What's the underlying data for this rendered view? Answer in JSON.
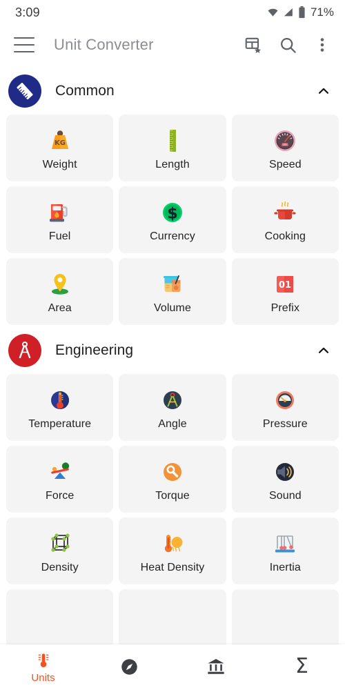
{
  "status_bar": {
    "time": "3:09",
    "battery_percent": "71%",
    "icons": [
      "wifi-icon",
      "signal-icon",
      "battery-icon"
    ]
  },
  "app_bar": {
    "menu_icon": "hamburger-menu-icon",
    "title": "Unit Converter",
    "actions": [
      {
        "name": "favorites-table-icon",
        "label": "Favorites"
      },
      {
        "name": "search-icon",
        "label": "Search"
      },
      {
        "name": "overflow-menu-icon",
        "label": "More options"
      }
    ]
  },
  "sections": [
    {
      "id": "common",
      "title": "Common",
      "icon": "ruler-icon",
      "circle_color": "#1f2b87",
      "expanded": true,
      "chevron": "chevron-up-icon",
      "items": [
        {
          "label": "Weight",
          "icon": "weight-kg-icon"
        },
        {
          "label": "Length",
          "icon": "ruler-green-icon"
        },
        {
          "label": "Speed",
          "icon": "speedometer-icon"
        },
        {
          "label": "Fuel",
          "icon": "fuel-pump-icon"
        },
        {
          "label": "Currency",
          "icon": "dollar-coin-icon"
        },
        {
          "label": "Cooking",
          "icon": "cooking-pot-icon"
        },
        {
          "label": "Area",
          "icon": "map-pin-icon"
        },
        {
          "label": "Volume",
          "icon": "beakers-icon"
        },
        {
          "label": "Prefix",
          "icon": "calendar-01-icon"
        }
      ]
    },
    {
      "id": "engineering",
      "title": "Engineering",
      "icon": "compass-divider-icon",
      "circle_color": "#cf2027",
      "expanded": true,
      "chevron": "chevron-up-icon",
      "items": [
        {
          "label": "Temperature",
          "icon": "thermometer-circle-icon"
        },
        {
          "label": "Angle",
          "icon": "protractor-compass-icon"
        },
        {
          "label": "Pressure",
          "icon": "pressure-gauge-icon"
        },
        {
          "label": "Force",
          "icon": "seesaw-lever-icon"
        },
        {
          "label": "Torque",
          "icon": "wrench-gear-icon"
        },
        {
          "label": "Sound",
          "icon": "speaker-sound-icon"
        },
        {
          "label": "Density",
          "icon": "cube-lattice-icon"
        },
        {
          "label": "Heat Density",
          "icon": "thermometer-drip-icon"
        },
        {
          "label": "Inertia",
          "icon": "newtons-cradle-icon"
        }
      ]
    }
  ],
  "bottom_nav": {
    "active_index": 0,
    "active_color": "#f4511e",
    "inactive_color": "#3c4043",
    "items": [
      {
        "label": "Units",
        "icon": "thermometer-icon"
      },
      {
        "label": "",
        "icon": "compass-icon"
      },
      {
        "label": "",
        "icon": "bank-icon"
      },
      {
        "label": "",
        "icon": "sigma-icon"
      }
    ]
  }
}
